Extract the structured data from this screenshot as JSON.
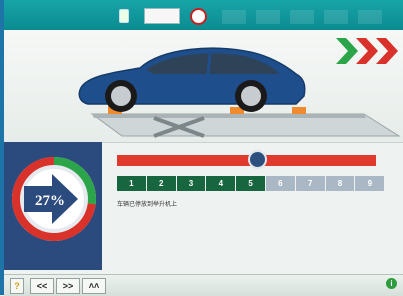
{
  "toolbar": {
    "badge_text": "",
    "tabs": [
      "",
      "",
      "",
      "",
      ""
    ]
  },
  "gauge": {
    "percent_label": "27%",
    "progress": 0.27
  },
  "steps": {
    "items": [
      "1",
      "2",
      "3",
      "4",
      "5",
      "6",
      "7",
      "8",
      "9"
    ],
    "active_count": 5
  },
  "slider": {
    "value": 0.54
  },
  "caption": "车辆已停放到举升机上",
  "bottom_bar": {
    "help": "?",
    "prev": "<<",
    "next": ">>",
    "up": "˄˄",
    "info": "i"
  },
  "colors": {
    "accent_teal": "#0f979b",
    "active_green": "#17663f",
    "inactive_gray": "#aab7c4",
    "bar_red": "#e03a2e",
    "gauge_navy": "#2b4a7d",
    "car_blue": "#1e4f8c",
    "chevron_green": "#2ca44a",
    "chevron_red": "#d9322a"
  }
}
